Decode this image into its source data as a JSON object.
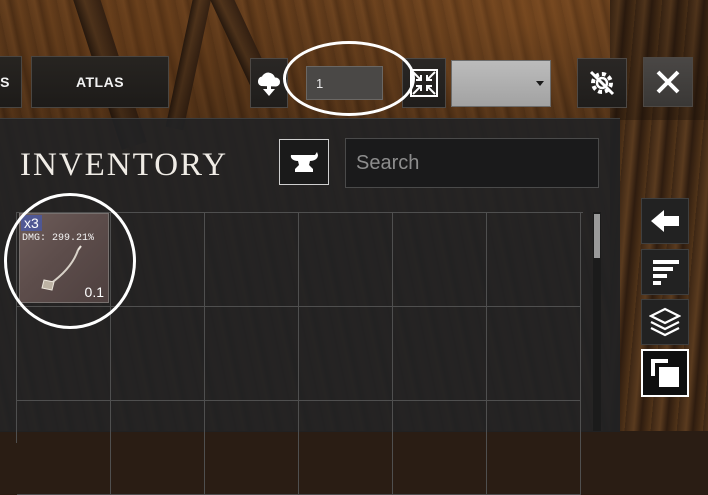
{
  "topbar": {
    "prev_tab_label": "S",
    "atlas_tab_label": "ATLAS",
    "quantity_value": "1"
  },
  "inventory": {
    "title": "INVENTORY",
    "search_placeholder": "Search",
    "columns": 6,
    "items": [
      {
        "quantity": "x3",
        "stat": "DMG: 299.21%",
        "level": "0.1"
      }
    ]
  },
  "icons": {
    "download": "cloud-download-icon",
    "compress": "compress-arrows-icon",
    "gear": "gear-slash-icon",
    "close": "close-icon",
    "anvil": "anvil-icon",
    "back": "arrow-left-icon",
    "sort": "sort-lines-icon",
    "layers": "layers-icon",
    "copy": "copy-icon"
  }
}
